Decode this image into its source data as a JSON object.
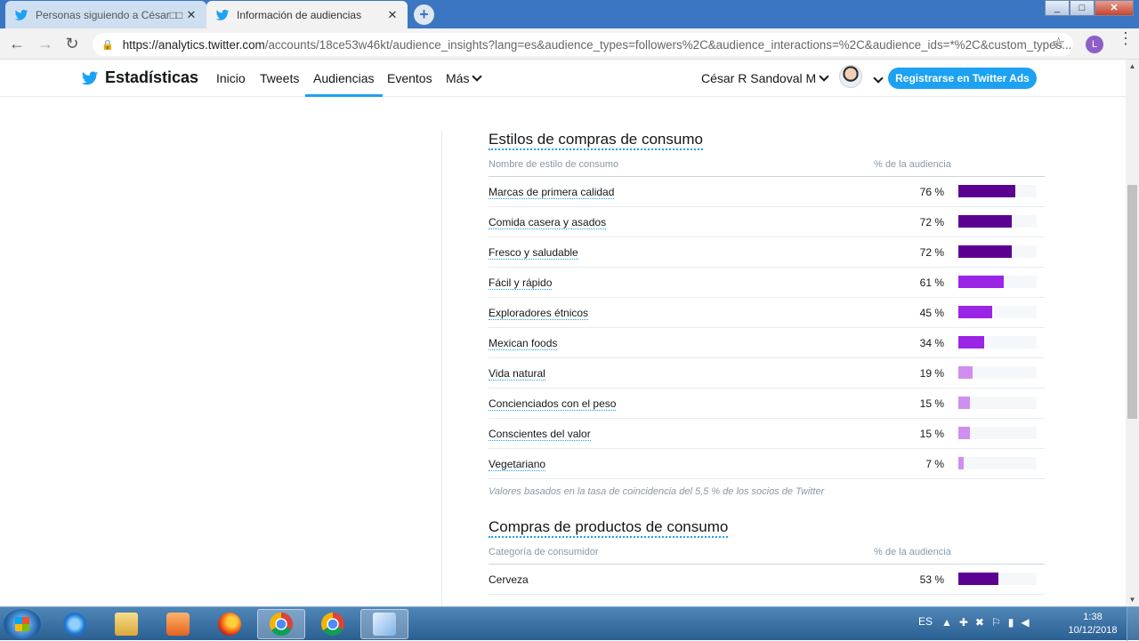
{
  "browser": {
    "tabs": [
      {
        "title": "Personas siguiendo a César□□ (@",
        "active": false
      },
      {
        "title": "Información de audiencias",
        "active": true
      }
    ],
    "url_host": "https://analytics.twitter.com",
    "url_path": "/accounts/18ce53w46kt/audience_insights?lang=es&audience_types=followers%2C&audience_interactions=%2C&audience_ids=*%2C&custom_types...",
    "profile_initial": "L"
  },
  "appnav": {
    "brand": "Estadísticas",
    "items": [
      "Inicio",
      "Tweets",
      "Audiencias",
      "Eventos",
      "Más"
    ],
    "active_item": "Audiencias",
    "user_name": "César R Sandoval M",
    "ads_button": "Registrarse en Twitter Ads"
  },
  "colors": {
    "twitter_blue": "#1da1f2",
    "bar_dark": "#5c0092",
    "bar_mid": "#9b25e6",
    "bar_light": "#d08ef0"
  },
  "section1": {
    "title": "Estilos de compras de consumo",
    "col_name": "Nombre de estilo de consumo",
    "col_pct": "% de la audiencia",
    "rows": [
      {
        "name": "Marcas de primera calidad",
        "pct": "76 %",
        "value": 76,
        "tier": "dark"
      },
      {
        "name": "Comida casera y asados",
        "pct": "72 %",
        "value": 72,
        "tier": "dark"
      },
      {
        "name": "Fresco y saludable",
        "pct": "72 %",
        "value": 72,
        "tier": "dark"
      },
      {
        "name": "Fácil y rápido",
        "pct": "61 %",
        "value": 61,
        "tier": "mid"
      },
      {
        "name": "Exploradores étnicos",
        "pct": "45 %",
        "value": 45,
        "tier": "mid"
      },
      {
        "name": "Mexican foods",
        "pct": "34 %",
        "value": 34,
        "tier": "mid"
      },
      {
        "name": "Vida natural",
        "pct": "19 %",
        "value": 19,
        "tier": "light"
      },
      {
        "name": "Concienciados con el peso",
        "pct": "15 %",
        "value": 15,
        "tier": "light"
      },
      {
        "name": "Conscientes del valor",
        "pct": "15 %",
        "value": 15,
        "tier": "light"
      },
      {
        "name": "Vegetariano",
        "pct": "7 %",
        "value": 7,
        "tier": "light"
      }
    ],
    "note": "Valores basados en la tasa de coincidencia del 5,5 % de los socios de Twitter"
  },
  "section2": {
    "title": "Compras de productos de consumo",
    "col_name": "Categoría de consumidor",
    "col_pct": "% de la audiencia",
    "rows": [
      {
        "name": "Cerveza",
        "pct": "53 %",
        "value": 53,
        "tier": "dark"
      }
    ]
  },
  "taskbar": {
    "lang": "ES",
    "time": "1:38",
    "date": "10/12/2018"
  }
}
